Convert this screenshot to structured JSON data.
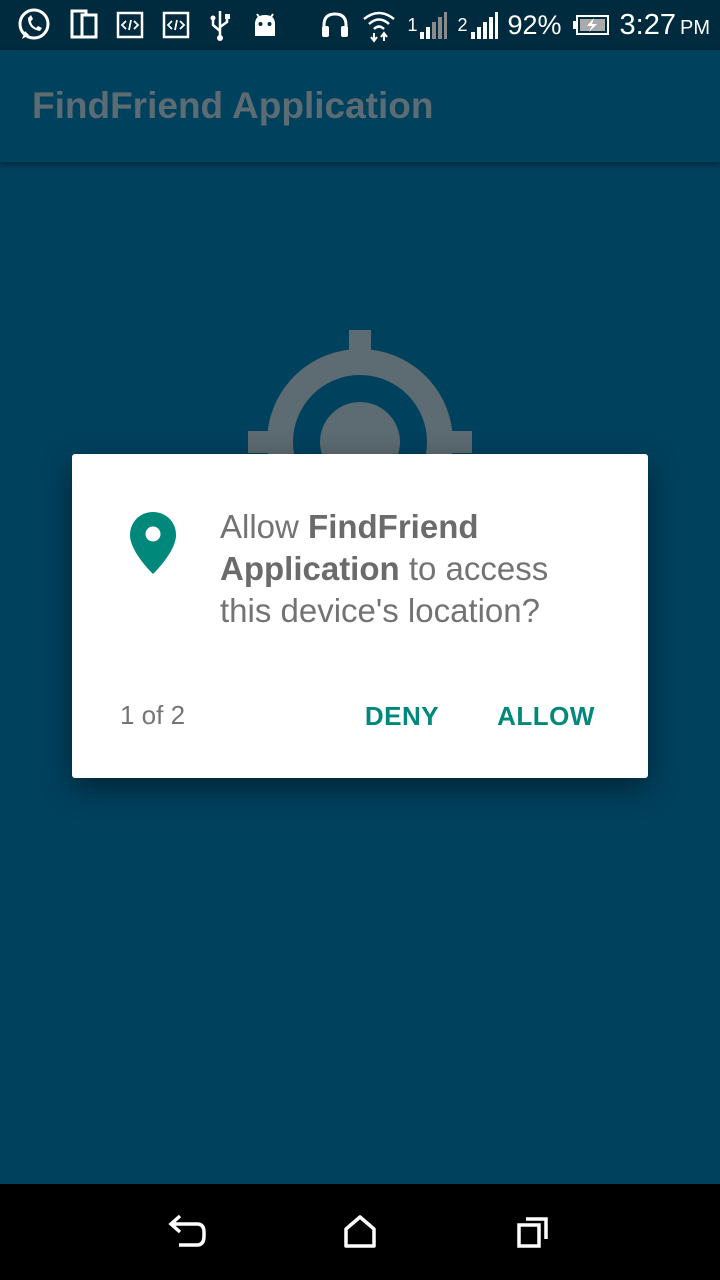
{
  "status_bar": {
    "icons_left": [
      "whatsapp-icon",
      "dual-screen-icon",
      "code-icon",
      "code-icon",
      "usb-icon",
      "android-icon"
    ],
    "icons_right": [
      "headset-icon",
      "wifi-icon",
      "signal-sim1-icon",
      "signal-sim2-icon"
    ],
    "sim1_label": "1",
    "sim2_label": "2",
    "battery": "92%",
    "time": "3:27",
    "ampm": "PM"
  },
  "app_bar": {
    "title": "FindFriend Application"
  },
  "content": {
    "icon": "gps-target-icon"
  },
  "dialog": {
    "icon": "location-pin-icon",
    "message_prefix": "Allow ",
    "message_app_name": "FindFriend Application",
    "message_suffix": " to access this device's location?",
    "counter": "1 of 2",
    "deny_label": "DENY",
    "allow_label": "ALLOW",
    "accent_color": "#00897b"
  },
  "nav_bar": {
    "buttons": [
      "back-icon",
      "home-icon",
      "recents-icon"
    ]
  },
  "colors": {
    "background": "#00415e",
    "status_bar": "#002a3d",
    "title": "#5d6b72"
  }
}
